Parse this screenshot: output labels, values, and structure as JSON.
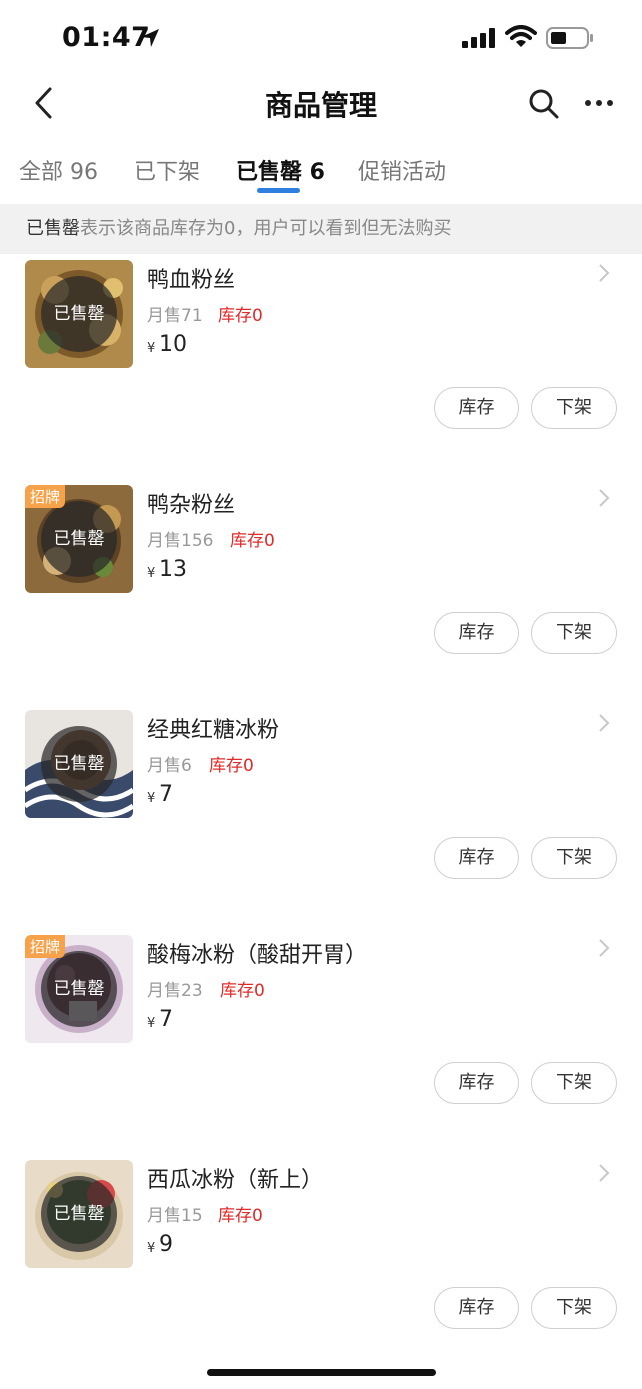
{
  "status_bar": {
    "time": "01:47"
  },
  "nav": {
    "title": "商品管理"
  },
  "tabs": [
    {
      "label": "全部 96"
    },
    {
      "label": "已下架"
    },
    {
      "label": "已售罄 6"
    },
    {
      "label": "促销活动"
    }
  ],
  "notice": {
    "strong": "已售罄",
    "text": "表示该商品库存为0，用户可以看到但无法购买"
  },
  "items": [
    {
      "name": "鸭血粉丝",
      "sales": "月售71",
      "stock": "库存0",
      "price_symbol": "¥",
      "price": "10",
      "badge": "已售罄",
      "tag": ""
    },
    {
      "name": "鸭杂粉丝",
      "sales": "月售156",
      "stock": "库存0",
      "price_symbol": "¥",
      "price": "13",
      "badge": "已售罄",
      "tag": "招牌"
    },
    {
      "name": "经典红糖冰粉",
      "sales": "月售6",
      "stock": "库存0",
      "price_symbol": "¥",
      "price": "7",
      "badge": "已售罄",
      "tag": ""
    },
    {
      "name": "酸梅冰粉（酸甜开胃）",
      "sales": "月售23",
      "stock": "库存0",
      "price_symbol": "¥",
      "price": "7",
      "badge": "已售罄",
      "tag": "招牌"
    },
    {
      "name": "西瓜冰粉（新上）",
      "sales": "月售15",
      "stock": "库存0",
      "price_symbol": "¥",
      "price": "9",
      "badge": "已售罄",
      "tag": ""
    }
  ],
  "buttons": {
    "stock": "库存",
    "off_shelf": "下架"
  },
  "colors": {
    "accent": "#2f7fe0",
    "stock_red": "#e02a2a",
    "tag_orange": "#f5a24b"
  }
}
